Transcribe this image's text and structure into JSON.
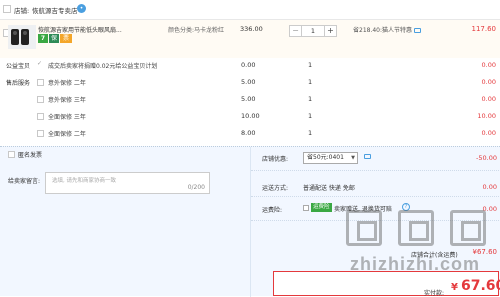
{
  "shop": {
    "label": "店铺:",
    "name": "恢航源吉专卖店",
    "chat_icon": "wangwang-icon"
  },
  "item": {
    "title": "恢航源吉家用节能低头眼风扇...",
    "sku": "颜色分类:马卡龙粉红",
    "badges": [
      "7",
      "保",
      "票"
    ],
    "unit_price": "336.00",
    "quantity": "1",
    "qty_minus": "−",
    "qty_plus": "+",
    "promo": "省218.40:猫人节特惠",
    "subtotal": "117.60"
  },
  "services": [
    {
      "category": "公益宝贝",
      "checked": true,
      "name": "成交后卖家将捐赠0.02元给公益宝贝计划",
      "price": "0.00",
      "qty": "1",
      "subtotal": "0.00"
    },
    {
      "category": "售后服务",
      "checked": false,
      "name": "意外保修 二年",
      "price": "5.00",
      "qty": "1",
      "subtotal": "0.00"
    },
    {
      "category": "",
      "checked": false,
      "name": "意外保修 三年",
      "price": "5.00",
      "qty": "1",
      "subtotal": "0.00"
    },
    {
      "category": "",
      "checked": false,
      "name": "全面保修 三年",
      "price": "10.00",
      "qty": "1",
      "subtotal": "10.00"
    },
    {
      "category": "",
      "checked": false,
      "name": "全面保修 二年",
      "price": "8.00",
      "qty": "1",
      "subtotal": "0.00"
    }
  ],
  "options": {
    "anonymous_label": "匿名发票",
    "message_label": "给卖家留言:",
    "message_placeholder": "选填, 请先和商家协商一致",
    "message_count": "0/200",
    "coupon_label": "店铺优惠:",
    "coupon_value": "省50元:0401",
    "coupon_discount": "-50.00",
    "shipping_label": "运送方式:",
    "shipping_text": "普通配送 快递 免邮",
    "shipping_fee": "0.00",
    "insurance_label": "运费险:",
    "insurance_badge": "运费险",
    "insurance_text": "卖家赠送, 退换货可赔",
    "insurance_fee": "0.00",
    "shop_total_label": "店铺合计(含运费)",
    "shop_total_value": "¥67.60"
  },
  "payment": {
    "label": "实付款:",
    "currency": "¥",
    "value": "67.60"
  },
  "watermark": {
    "text": "zhizhizhi.com"
  },
  "colors": {
    "price_red": "#e4393c",
    "item_bg": "#fffbf4",
    "options_bg": "#f2f7ff",
    "badge_green": "#3aa843",
    "link_blue": "#4a9fe0"
  }
}
